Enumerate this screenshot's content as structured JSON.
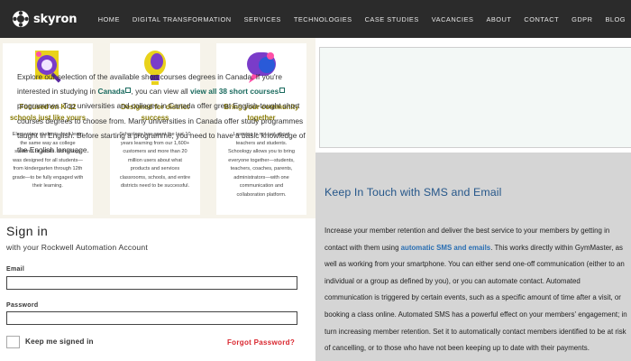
{
  "header": {
    "logo_text": "skyron",
    "nav": [
      "HOME",
      "DIGITAL TRANSFORMATION",
      "SERVICES",
      "TECHNOLOGIES",
      "CASE STUDIES",
      "VACANCIES",
      "ABOUT",
      "CONTACT",
      "GDPR",
      "BLOG"
    ]
  },
  "cards": [
    {
      "icon": "magnifier-icon",
      "title": "Focused on K-12 schools just like yours",
      "text": "Elementary students don't learn the same way as college students or adults. Schoology was designed for all students—from kindergarten through 12th grade—to be fully engaged with their learning."
    },
    {
      "icon": "lightbulb-icon",
      "title": "Designed for district success",
      "text": "Schoology has spent the last 10 years learning from our 1,600+ customers and more than 20 million users about what products and services classrooms, schools, and entire districts need to be successful."
    },
    {
      "icon": "chat-bubble-icon",
      "title": "Bring your community together",
      "text": "Learning is not just about teachers and students. Schoology allows you to bring everyone together—students, teachers, coaches, parents, administrators—with one communication and collaboration platform."
    }
  ],
  "signin": {
    "title": "Sign in",
    "subtitle": "with your Rockwell Automation Account",
    "email_label": "Email",
    "password_label": "Password",
    "keep_signed_in": "Keep me signed in",
    "forgot": "Forgot Password?"
  },
  "study": {
    "p1": "Explore our selection of the available short courses degrees in Canada. If you're interested in studying in ",
    "link_canada": "Canada",
    "p2": ", you can view all ",
    "link_all": "view all 38 short courses",
    "p3": " programmes. Top universities and colleges in Canada offer great English-taught short courses degrees to choose from. Many universities in Canada offer study programmes taught in English. Before starting a programme, you need to have a basic knowledge of the English language."
  },
  "sms": {
    "title": "Keep In Touch with SMS and Email",
    "p1": "Increase your member retention and deliver the best service to your members by getting in contact with them using ",
    "link": "automatic SMS and emails",
    "p2": ". This works directly within GymMaster, as well as working from your smartphone. You can either send one-off communication (either to an individual or a group as defined by you), or you can automate contact. Automated communication is triggered by certain events, such as a specific amount of time after a visit, or booking a class online. Automated SMS has a powerful effect on your members' engagement; in turn increasing member retention. Set it to automatically contact members identified to be at risk of cancelling, or to those who have not been keeping up to date with their payments."
  },
  "colors": {
    "topbar": "#2b2b2b",
    "card_title": "#8a7d08",
    "forgot_link": "#d9262e",
    "study_link": "#1a6a5e",
    "sms_title": "#26578a",
    "sms_link": "#2a6fb3",
    "sms_bg": "#d5d5d5"
  }
}
